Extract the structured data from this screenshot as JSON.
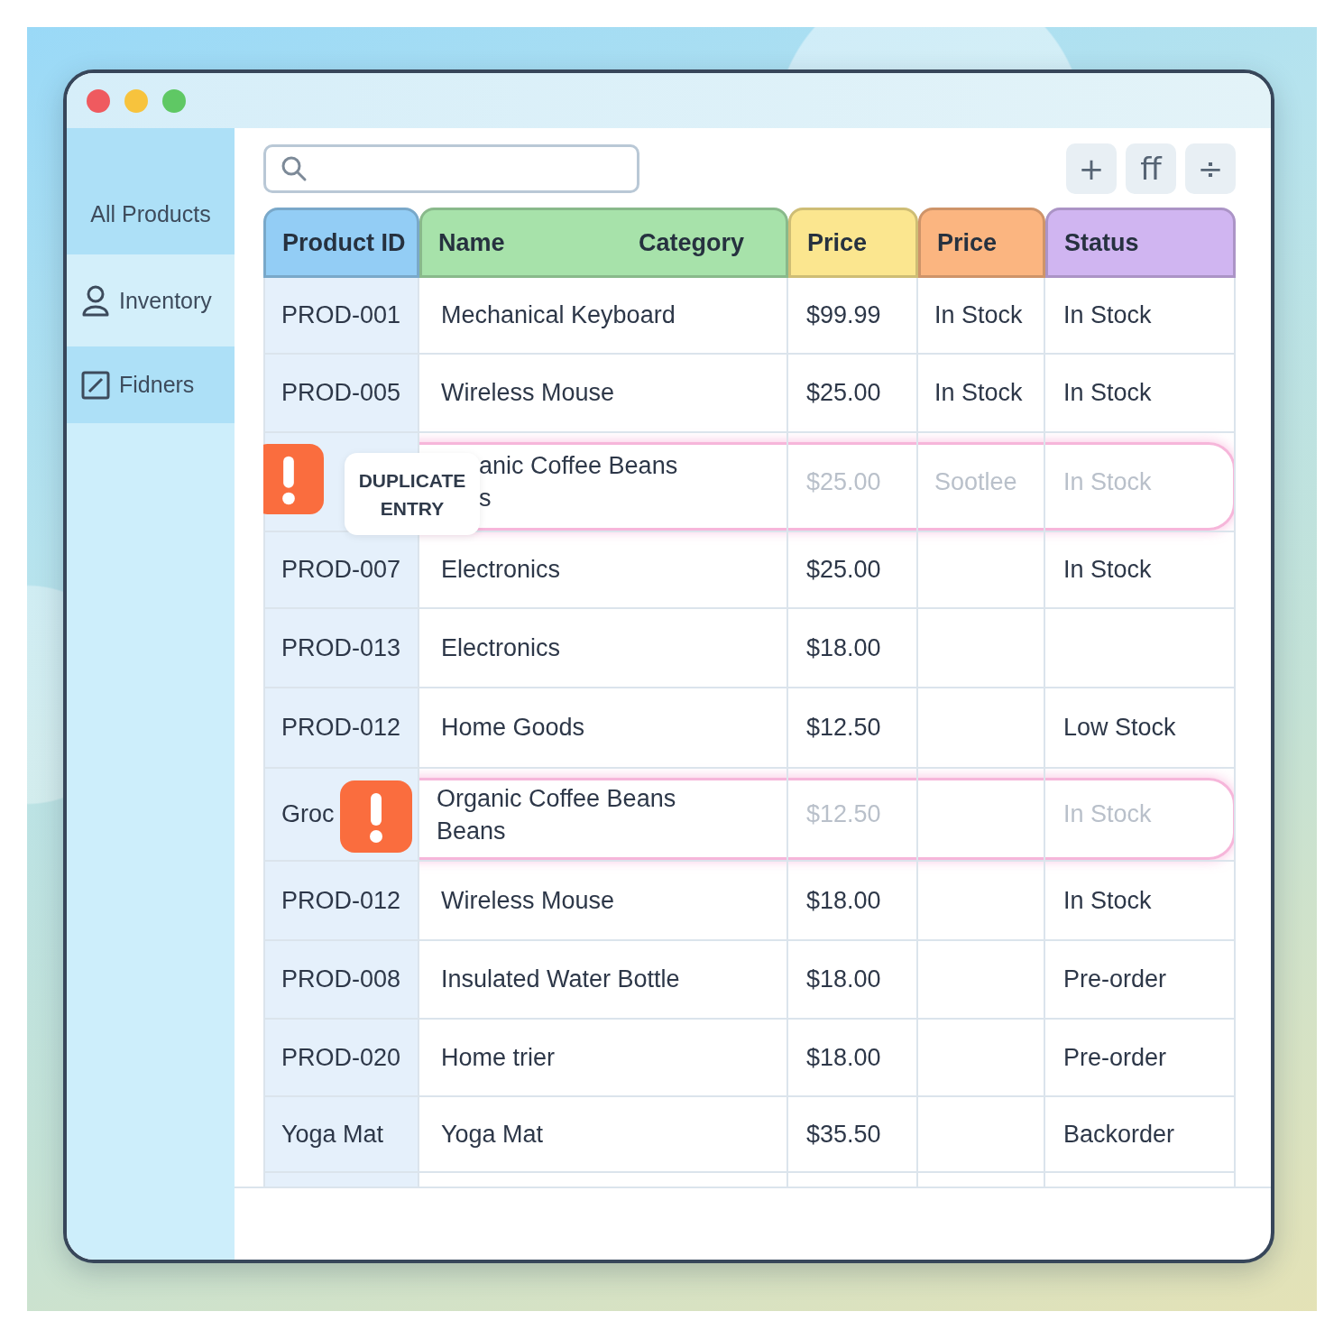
{
  "window": {
    "controls": [
      {
        "color": "#ef5a5f"
      },
      {
        "color": "#f7c33d"
      },
      {
        "color": "#5fc864"
      }
    ]
  },
  "sidebar": {
    "items": [
      {
        "label": "All Products",
        "selected": true
      },
      {
        "label": "Inventory",
        "selected": false
      },
      {
        "label": "Fidners",
        "selected": true
      }
    ]
  },
  "toolbar": {
    "buttons": [
      "+",
      "ff",
      "÷"
    ]
  },
  "table": {
    "columns": [
      {
        "labels": [
          "Product ID"
        ],
        "color": "#93cdf5"
      },
      {
        "labels": [
          "Name",
          "Category"
        ],
        "color": "#a7e2aa"
      },
      {
        "labels": [
          "Price"
        ],
        "color": "#fbe68f"
      },
      {
        "labels": [
          "Price"
        ],
        "color": "#fbb580"
      },
      {
        "labels": [
          "Status"
        ],
        "color": "#d0b5f1"
      }
    ],
    "rows": [
      {
        "kind": "product",
        "id": "PROD-001",
        "name": "Mechanical Keyboard",
        "price": "$99.99",
        "stock": "In Stock",
        "status": "In Stock"
      },
      {
        "kind": "product",
        "id": "PROD-005",
        "name": "Wireless Mouse",
        "price": "$25.00",
        "stock": "In Stock",
        "status": "In Stock"
      },
      {
        "kind": "duplicate",
        "badge": [
          "DUPLICATE",
          "ENTRY"
        ],
        "name_lines": [
          "anic Coffee Beans",
          "s"
        ],
        "price": "$25.00",
        "stock": "Sootlee",
        "status": "In Stock"
      },
      {
        "kind": "product",
        "id": "PROD-007",
        "name": "Electronics",
        "price": "$25.00",
        "status": "In Stock"
      },
      {
        "kind": "product",
        "id": "PROD-013",
        "name": "Electronics",
        "price": "$18.00"
      },
      {
        "kind": "product",
        "id": "PROD-012",
        "name": "Home Goods",
        "price": "$12.50",
        "status": "Low Stock"
      },
      {
        "kind": "duplicate",
        "id": "Groc",
        "name_lines": [
          "Organic Coffee Beans",
          "Beans"
        ],
        "price": "$12.50",
        "status": "In Stock"
      },
      {
        "kind": "product",
        "id": "PROD-012",
        "name": "Wireless Mouse",
        "price": "$18.00",
        "status": "In Stock"
      },
      {
        "kind": "product",
        "id": "PROD-008",
        "name": "Insulated Water Bottle",
        "price": "$18.00",
        "status": "Pre-order"
      },
      {
        "kind": "product",
        "id": "PROD-020",
        "name": "Home trier",
        "price": "$18.00",
        "status": "Pre-order"
      },
      {
        "kind": "product",
        "id": "Yoga Mat",
        "name": "Yoga Mat",
        "price": "$35.50",
        "status": "Backorder"
      }
    ]
  }
}
